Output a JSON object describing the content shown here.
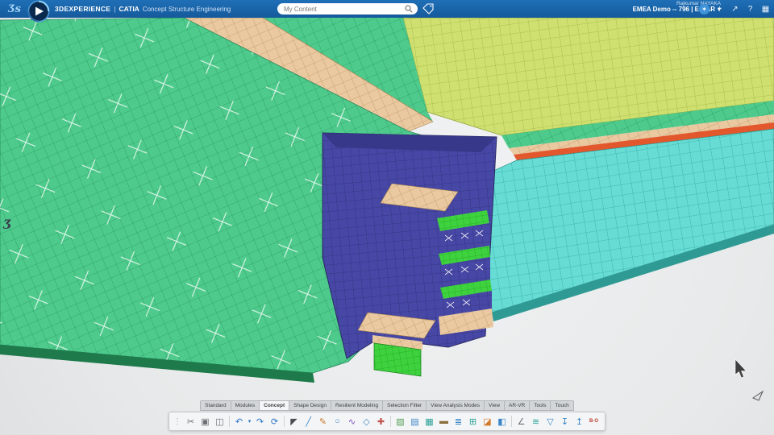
{
  "top_bar": {
    "logo_glyph": "Ʒs",
    "brand": "3DEXPERIENCE",
    "divider": "|",
    "app": "CATIA",
    "subtitle": "Concept Structure Engineering",
    "search": {
      "placeholder": "My Content"
    },
    "user": {
      "name": "Rajkumar NAYAKA",
      "workspace": "EMEA Demo -- 796 | E-CAR",
      "caret": "▾"
    },
    "icons": {
      "badge": "✶",
      "add": "+",
      "share": "↗",
      "help": "?",
      "apps": "▦"
    }
  },
  "viewport": {
    "watermark": "Ʒ",
    "colors": {
      "green_base": "#4ecb8c",
      "green_line": "#2a9a63",
      "green_dark_edge": "#1e7a4b",
      "tan_base": "#eac9a0",
      "tan_line": "#bf9668",
      "yellow_base": "#cfe070",
      "yellow_line": "#a2b646",
      "cyan_base": "#66dcd4",
      "cyan_line": "#35aca6",
      "cyan_edge": "#2f9a94",
      "blue_base": "#4747a6",
      "blue_line": "#32327c",
      "blue_shade": "#38388a",
      "bright_base": "#3fd23f",
      "bright_line": "#1fa51f",
      "orange_edge": "#e2572c",
      "xmark": "#ffffff"
    }
  },
  "tabs": {
    "items": [
      "Standard",
      "Modules",
      "Concept",
      "Shape Design",
      "Resilient Modeling",
      "Selection Filter",
      "View Analysis Modes",
      "View",
      "AR-VR",
      "Tools",
      "Touch"
    ],
    "active": "Concept"
  },
  "toolbar": {
    "handle_glyph": "⋮",
    "items": [
      {
        "name": "cut",
        "glyph": "✂",
        "color": "#6b6f73"
      },
      {
        "name": "copy",
        "glyph": "▣",
        "color": "#6b6f73"
      },
      {
        "name": "paste",
        "glyph": "◫",
        "color": "#6b6f73"
      },
      {
        "name": "undo",
        "glyph": "↶",
        "color": "#2a72c9"
      },
      {
        "name": "undo-options",
        "glyph": "▾",
        "color": "#2a72c9"
      },
      {
        "name": "redo",
        "glyph": "↷",
        "color": "#2a72c9"
      },
      {
        "name": "history",
        "glyph": "⟳",
        "color": "#2a72c9"
      },
      {
        "name": "select",
        "glyph": "◤",
        "color": "#4a4e52"
      },
      {
        "name": "line",
        "glyph": "╱",
        "color": "#3a86c8"
      },
      {
        "name": "sketch",
        "glyph": "✎",
        "color": "#c77b2f"
      },
      {
        "name": "circle",
        "glyph": "○",
        "color": "#3a86c8"
      },
      {
        "name": "spline",
        "glyph": "∿",
        "color": "#7a4fc0"
      },
      {
        "name": "plane",
        "glyph": "◇",
        "color": "#3a86c8"
      },
      {
        "name": "axis",
        "glyph": "✚",
        "color": "#c0504d"
      },
      {
        "name": "extrude",
        "glyph": "▧",
        "color": "#57a05a"
      },
      {
        "name": "panel",
        "glyph": "▤",
        "color": "#3a86c8"
      },
      {
        "name": "plate",
        "glyph": "▦",
        "color": "#2aa198"
      },
      {
        "name": "beam",
        "glyph": "▬",
        "color": "#8a6d3b"
      },
      {
        "name": "stiffener",
        "glyph": "≣",
        "color": "#3a86c8"
      },
      {
        "name": "grid",
        "glyph": "⊞",
        "color": "#2aa198"
      },
      {
        "name": "section",
        "glyph": "◪",
        "color": "#d07a2a"
      },
      {
        "name": "split",
        "glyph": "◧",
        "color": "#3a86c8"
      },
      {
        "name": "measure",
        "glyph": "∠",
        "color": "#6b6f73"
      },
      {
        "name": "analysis",
        "glyph": "≋",
        "color": "#2aa198"
      },
      {
        "name": "views",
        "glyph": "▽",
        "color": "#3a86c8"
      },
      {
        "name": "import",
        "glyph": "↧",
        "color": "#3a86c8"
      },
      {
        "name": "export",
        "glyph": "↥",
        "color": "#3a86c8"
      },
      {
        "name": "bom-table",
        "glyph": "B·O",
        "color": "#c0392b"
      }
    ]
  }
}
